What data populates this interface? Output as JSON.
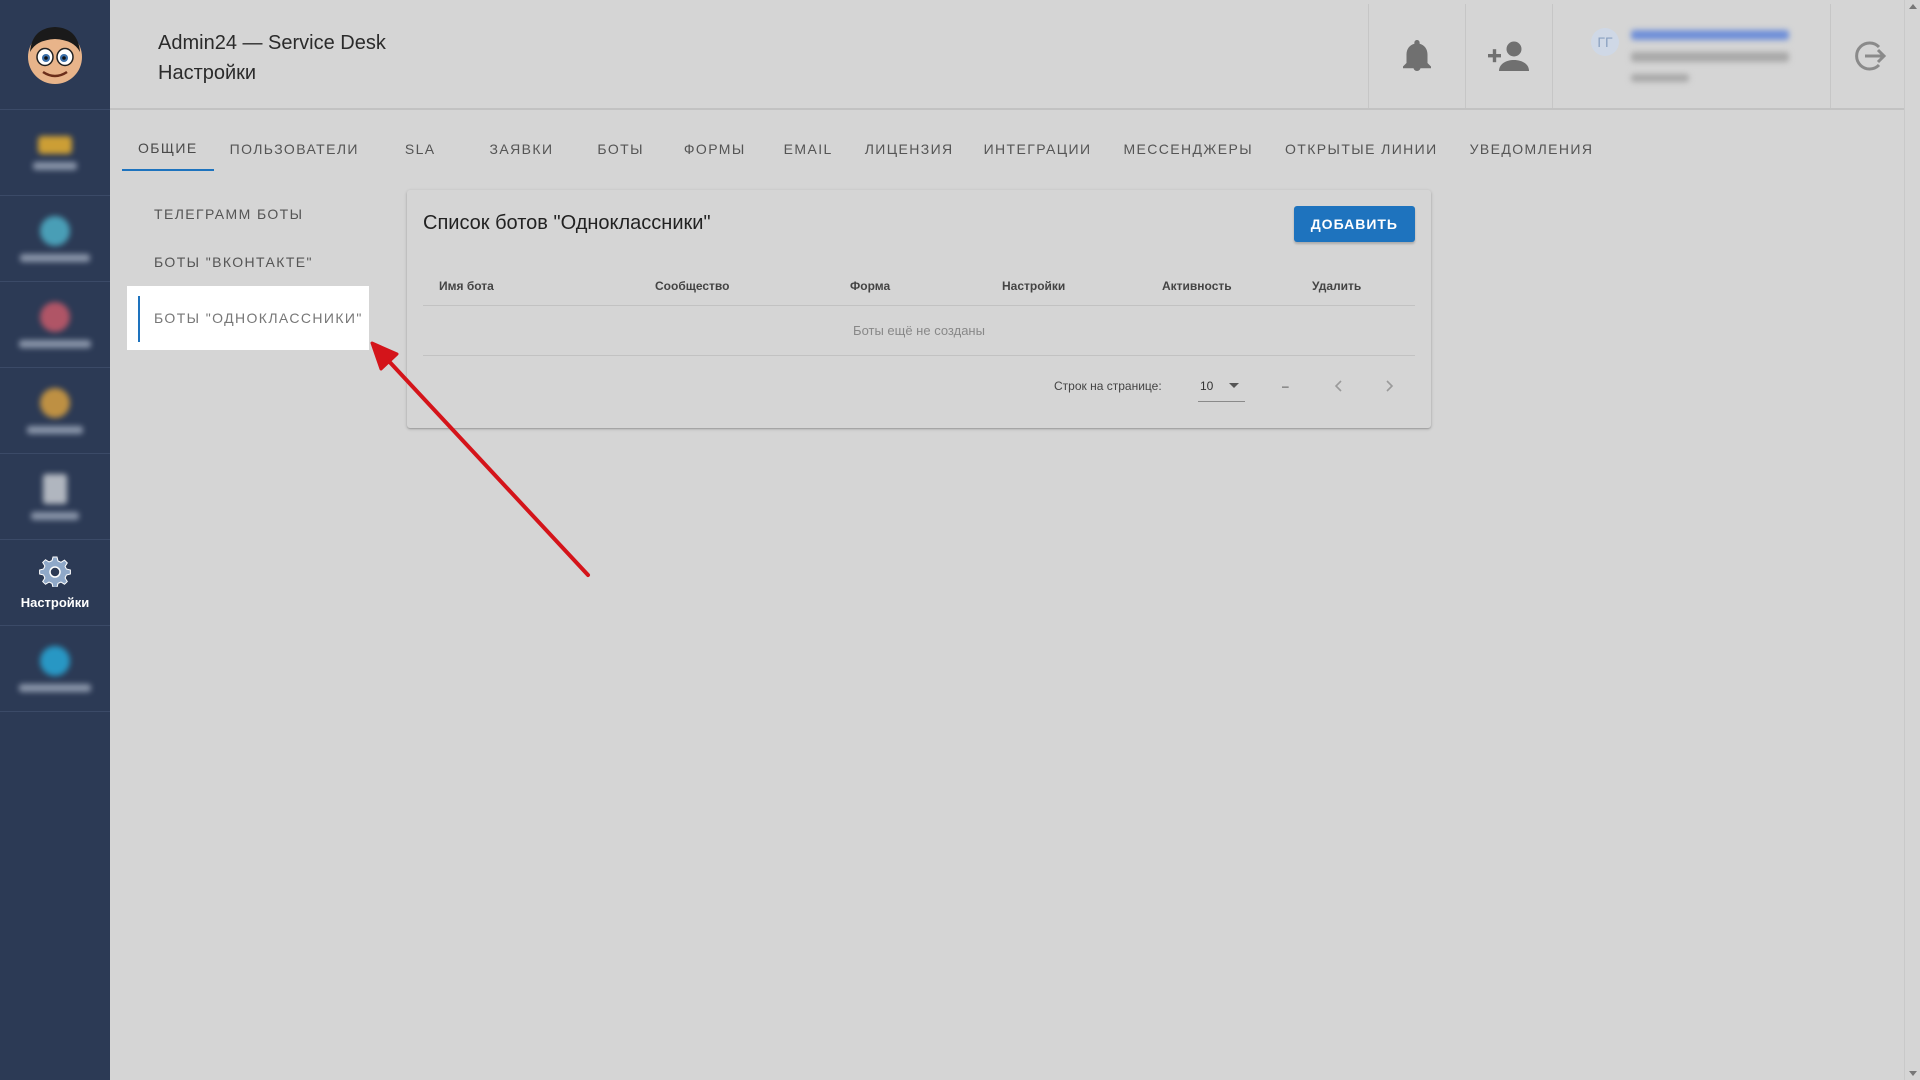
{
  "header": {
    "app_title": "Admin24 — Service Desk",
    "page_title": "Настройки",
    "user_initials": "ГГ"
  },
  "sidebar": {
    "active_label": "Настройки"
  },
  "tabs": [
    {
      "label": "ОБЩИЕ",
      "active": true
    },
    {
      "label": "ПОЛЬЗОВАТЕЛИ"
    },
    {
      "label": "SLA"
    },
    {
      "label": "ЗАЯВКИ"
    },
    {
      "label": "БОТЫ"
    },
    {
      "label": "ФОРМЫ"
    },
    {
      "label": "EMAIL"
    },
    {
      "label": "ЛИЦЕНЗИЯ"
    },
    {
      "label": "ИНТЕГРАЦИИ"
    },
    {
      "label": "МЕССЕНДЖЕРЫ"
    },
    {
      "label": "ОТКРЫТЫЕ ЛИНИИ"
    },
    {
      "label": "УВЕДОМЛЕНИЯ"
    }
  ],
  "subnav": [
    {
      "label": "ТЕЛЕГРАММ БОТЫ"
    },
    {
      "label": "БОТЫ \"ВКОНТАКТЕ\""
    },
    {
      "label": "БОТЫ \"ОДНОКЛАССНИКИ\"",
      "active": true
    }
  ],
  "card": {
    "title": "Список ботов \"Одноклассники\"",
    "add_button": "ДОБАВИТЬ",
    "columns": [
      "Имя бота",
      "Сообщество",
      "Форма",
      "Настройки",
      "Активность",
      "Удалить"
    ],
    "empty_text": "Боты ещё не созданы",
    "rows_per_page_label": "Строк на странице:",
    "rows_per_page_value": "10",
    "range_text": "–"
  },
  "colors": {
    "sidebar_bg": "#2c3a55",
    "accent": "#1e73be",
    "page_bg": "#d5d5d5",
    "annotation_arrow": "#d4141a"
  },
  "icons": [
    "bell-icon",
    "add-user-icon",
    "logout-icon",
    "settings-gear-icon",
    "chevron-left-icon",
    "chevron-right-icon"
  ]
}
